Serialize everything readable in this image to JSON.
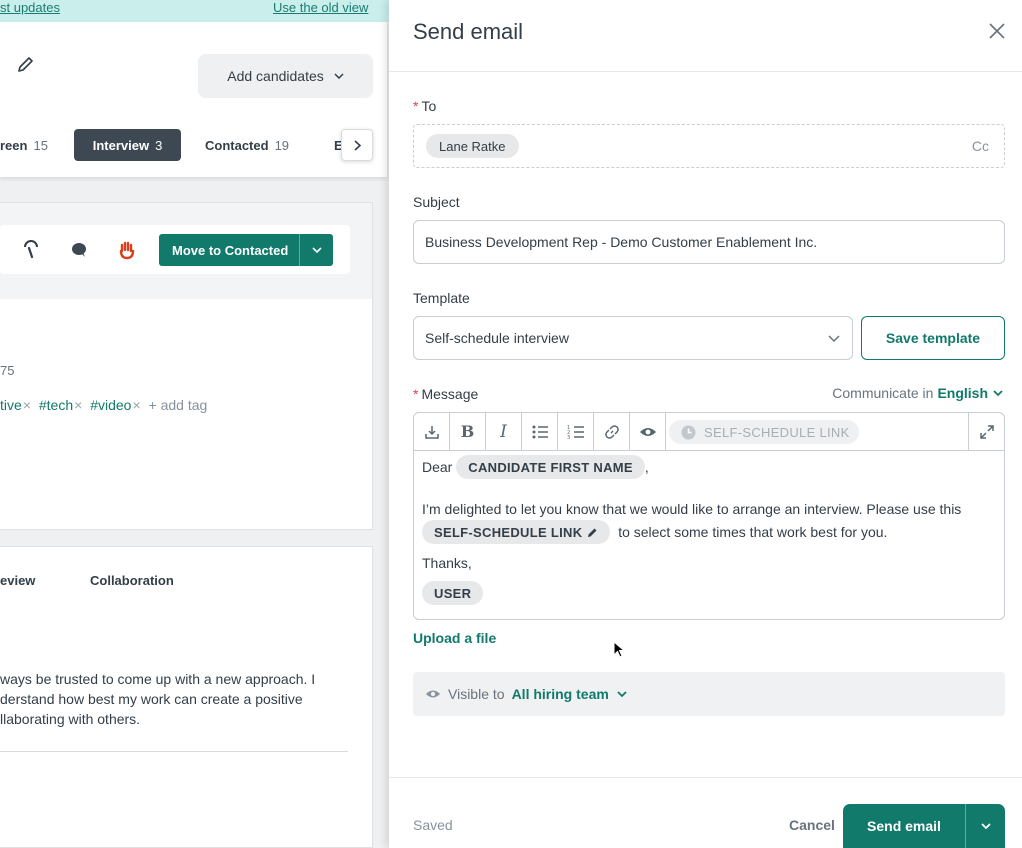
{
  "banner": {
    "link_left": "st updates",
    "link_right": "Use the old view"
  },
  "pipeline": {
    "add_candidates": "Add candidates",
    "stages": [
      {
        "label": "reen",
        "count": "15"
      },
      {
        "label": "Interview",
        "count": "3"
      },
      {
        "label": "Contacted",
        "count": "19"
      },
      {
        "label": "E",
        "count": ""
      }
    ]
  },
  "candidate": {
    "move_button": "Move to Contacted",
    "number_fragment": "75",
    "tags": [
      "tive",
      "#tech",
      "#video"
    ],
    "add_tag": "+ add tag",
    "tabs": [
      "eview",
      "Collaboration"
    ],
    "paragraph": [
      "ways be trusted to come up with a new approach. I",
      "derstand how best my work can create a positive",
      "llaborating with others."
    ]
  },
  "drawer": {
    "title": "Send email",
    "to_label": "To",
    "to_recipients": [
      "Lane Ratke"
    ],
    "cc_label": "Cc",
    "subject_label": "Subject",
    "subject_value": "Business Development Rep - Demo Customer Enablement Inc.",
    "template_label": "Template",
    "template_value": "Self-schedule interview",
    "save_template": "Save template",
    "message_label": "Message",
    "communicate_in": "Communicate in",
    "language": "English",
    "toolbar_link_chip": "SELF-SCHEDULE LINK",
    "message": {
      "greeting": "Dear",
      "name_token": "CANDIDATE FIRST NAME",
      "comma": ",",
      "line2": "I’m delighted to let you know that we would like to arrange an interview. Please use this",
      "link_token": "SELF-SCHEDULE LINK",
      "line3_rest": "to select some times that work best for you.",
      "thanks": "Thanks,",
      "user_token": "USER"
    },
    "upload": "Upload a file",
    "visible_to": "Visible to",
    "visible_team": "All hiring team",
    "saved": "Saved",
    "cancel": "Cancel",
    "send": "Send email"
  },
  "colors": {
    "primary": "#117a6b",
    "required": "#d93f4c",
    "banner": "#c9eeec"
  }
}
